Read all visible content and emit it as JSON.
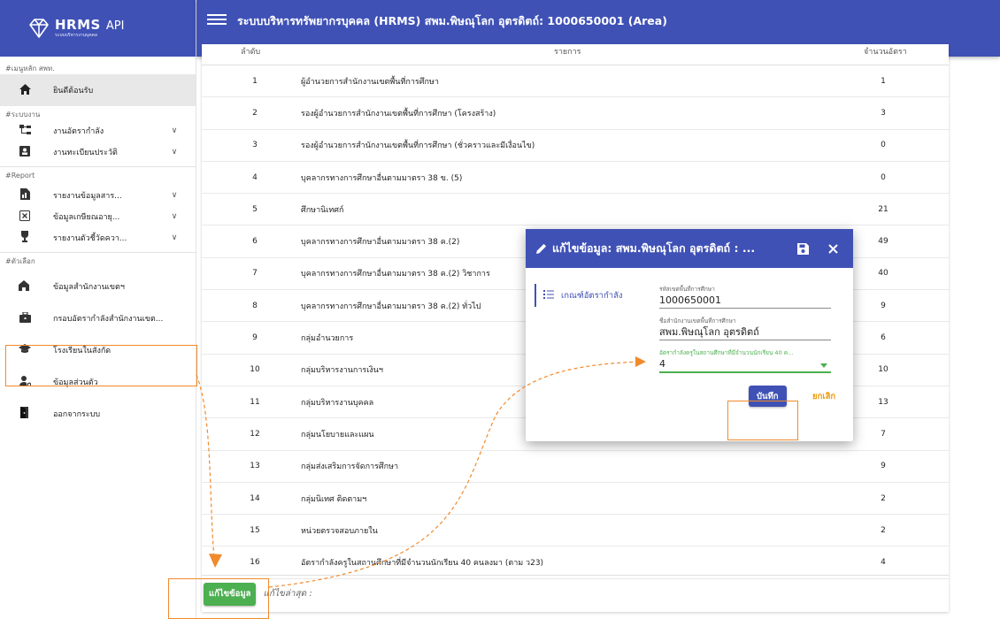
{
  "brand": {
    "name": "HRMS",
    "suffix": "API",
    "subtitle": "ระบบบริหารงานบุคคล"
  },
  "appbar": {
    "title": "ระบบบริหารทรัพยากรบุคคล (HRMS) สพม.พิษณุโลก อุตรดิตถ์: 1000650001 (Area)"
  },
  "sidebar": {
    "sections": {
      "main": "#เมนูหลัก สพท.",
      "system": "#ระบบงาน",
      "report": "#Report",
      "options": "#ตัวเลือก"
    },
    "items": [
      {
        "label": "ยินดีต้อนรับ",
        "icon": "home-icon"
      },
      {
        "label": "งานอัตรากำลัง",
        "icon": "sitemap-icon"
      },
      {
        "label": "งานทะเบียนประวัติ",
        "icon": "profile-card-icon"
      },
      {
        "label": "รายงานข้อมูลสาร...",
        "icon": "report-file-icon"
      },
      {
        "label": "ข้อมูลเกษียณอายุ...",
        "icon": "close-box-icon"
      },
      {
        "label": "รายงานตัวชี้วัดควา...",
        "icon": "trophy-icon"
      },
      {
        "label": "ข้อมูลสำนักงานเขตฯ",
        "icon": "office-icon"
      },
      {
        "label": "กรอบอัตรากำลังสำนักงานเขต...",
        "icon": "briefcase-icon"
      },
      {
        "label": "โรงเรียนในสังกัด",
        "icon": "school-icon"
      },
      {
        "label": "ข้อมูลส่วนตัว",
        "icon": "user-settings-icon"
      },
      {
        "label": "ออกจากระบบ",
        "icon": "exit-door-icon"
      }
    ]
  },
  "table": {
    "headers": {
      "no": "ลำดับ",
      "name": "รายการ",
      "count": "จำนวนอัตรา"
    },
    "rows": [
      {
        "no": "1",
        "name": "ผู้อำนวยการสำนักงานเขตพื้นที่การศึกษา",
        "count": "1"
      },
      {
        "no": "2",
        "name": "รองผู้อำนวยการสำนักงานเขตพื้นที่การศึกษา (โครงสร้าง)",
        "count": "3"
      },
      {
        "no": "3",
        "name": "รองผู้อำนวยการสำนักงานเขตพื้นที่การศึกษา (ชั่วคราวและมีเงื่อนไข)",
        "count": "0"
      },
      {
        "no": "4",
        "name": "บุคลากรทางการศึกษาอื่นตามมาตรา 38 ข. (5)",
        "count": "0"
      },
      {
        "no": "5",
        "name": "ศึกษานิเทศก์",
        "count": "21"
      },
      {
        "no": "6",
        "name": "บุคลากรทางการศึกษาอื่นตามมาตรา 38 ค.(2)",
        "count": "49"
      },
      {
        "no": "7",
        "name": "บุคลากรทางการศึกษาอื่นตามมาตรา 38 ค.(2) วิชาการ",
        "count": "40"
      },
      {
        "no": "8",
        "name": "บุคลากรทางการศึกษาอื่นตามมาตรา 38 ค.(2) ทั่วไป",
        "count": "9"
      },
      {
        "no": "9",
        "name": "กลุ่มอำนวยการ",
        "count": "6"
      },
      {
        "no": "10",
        "name": "กลุ่มบริหารงานการเงินฯ",
        "count": "10"
      },
      {
        "no": "11",
        "name": "กลุ่มบริหารงานบุคคล",
        "count": "13"
      },
      {
        "no": "12",
        "name": "กลุ่มนโยบายและแผน",
        "count": "7"
      },
      {
        "no": "13",
        "name": "กลุ่มส่งเสริมการจัดการศึกษา",
        "count": "9"
      },
      {
        "no": "14",
        "name": "กลุ่มนิเทศ ติดตามฯ",
        "count": "2"
      },
      {
        "no": "15",
        "name": "หน่วยตรวจสอบภายใน",
        "count": "2"
      },
      {
        "no": "16",
        "name": "อัตรากำลังครูในสถานศึกษาที่มีจำนวนนักเรียน 40 คนลงมา (ตาม ว23)",
        "count": "4"
      }
    ]
  },
  "footer": {
    "edit_label": "แก้ไขข้อมูล",
    "last_edit": "แก้ไขล่าสุด :"
  },
  "dialog": {
    "title": "แก้ไขข้อมูล: สพม.พิษณุโลก อุตรดิตถ์ : ...",
    "tab_label": "เกณฑ์อัตรากำลัง",
    "fields": {
      "area_code_label": "รหัสเขตพื้นที่การศึกษา",
      "area_code_value": "1000650001",
      "area_name_label": "ชื่อสำนักงานเขตพื้นที่การศึกษา",
      "area_name_value": "สพม.พิษณุโลก อุตรดิตถ์",
      "teacher_rate_label": "อัตรากำลังครูในสถานศึกษาที่มีจำนวนนักเรียน 40 ค...",
      "teacher_rate_value": "4"
    },
    "save_label": "บันทึก",
    "cancel_label": "ยกเลิก"
  },
  "colors": {
    "primary": "#3f51b5",
    "success": "#4caf50",
    "annotation": "#f08a2c",
    "cancel": "#f09b0a"
  }
}
